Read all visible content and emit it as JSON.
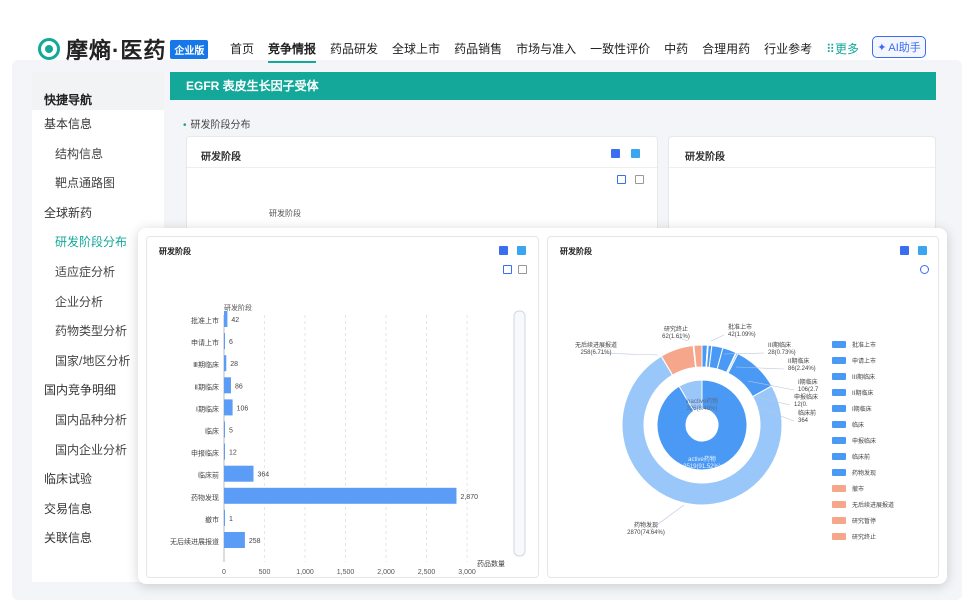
{
  "brand": {
    "name": "摩熵·医药",
    "badge": "企业版"
  },
  "nav": {
    "items": [
      "首页",
      "竞争情报",
      "药品研发",
      "全球上市",
      "药品销售",
      "市场与准入",
      "一致性评价",
      "中药",
      "合理用药",
      "行业参考"
    ],
    "active_index": 1,
    "more_label": "更多",
    "ai_label": "AI助手"
  },
  "sidebar": {
    "title": "快捷导航",
    "items": [
      {
        "label": "基本信息",
        "level": 0
      },
      {
        "label": "结构信息",
        "level": 1
      },
      {
        "label": "靶点通路图",
        "level": 1
      },
      {
        "label": "全球新药",
        "level": 0
      },
      {
        "label": "研发阶段分布",
        "level": 1,
        "selected": true
      },
      {
        "label": "适应症分析",
        "level": 1
      },
      {
        "label": "企业分析",
        "level": 1
      },
      {
        "label": "药物类型分析",
        "level": 1
      },
      {
        "label": "国家/地区分析",
        "level": 1
      },
      {
        "label": "国内竞争明细",
        "level": 0
      },
      {
        "label": "国内品种分析",
        "level": 1
      },
      {
        "label": "国内企业分析",
        "level": 1
      },
      {
        "label": "临床试验",
        "level": 0
      },
      {
        "label": "交易信息",
        "level": 0
      },
      {
        "label": "关联信息",
        "level": 0
      }
    ]
  },
  "main": {
    "header": "EGFR   表皮生长因子受体",
    "section_title": "研发阶段分布",
    "bg_card_left_title": "研发阶段",
    "bg_card_right_title": "研发阶段",
    "bg_chart_caption": "研发阶段"
  },
  "colors": {
    "accent": "#13a89a",
    "bar": "#5b9cf6",
    "ring_blue": "#4a9af5",
    "ring_orange": "#f6a68b",
    "ring_light": "#9ac7fa"
  },
  "chart_data": [
    {
      "type": "bar",
      "orientation": "horizontal",
      "title": "研发阶段",
      "caption": "研发阶段",
      "categories": [
        "批准上市",
        "申请上市",
        "III期临床",
        "II期临床",
        "I期临床",
        "临床",
        "申报临床",
        "临床前",
        "药物发现",
        "撤市",
        "无后续进展报道"
      ],
      "category_display": [
        "批准上市",
        "申请上市",
        "Ⅲ期临床",
        "Ⅱ期临床",
        "Ⅰ期临床",
        "临床",
        "申报临床",
        "临床前",
        "药物发现",
        "撤市",
        "无后续进展报道"
      ],
      "values": [
        42,
        6,
        28,
        86,
        106,
        5,
        12,
        364,
        2870,
        1,
        258
      ],
      "value_labels": [
        "42",
        "6",
        "28",
        "86",
        "106",
        "5",
        "12",
        "364",
        "2,870",
        "1",
        "258"
      ],
      "xlim": [
        0,
        3000
      ],
      "xticks": [
        "0",
        "500",
        "1,000",
        "1,500",
        "2,000",
        "2,500",
        "3,000"
      ],
      "xlabel": "药品数量",
      "grid": true
    },
    {
      "type": "pie",
      "title": "研发阶段",
      "inner": [
        {
          "name": "active药物",
          "value": 3519,
          "label": "active药物\n3519(91.52%)"
        },
        {
          "name": "inactive药物",
          "value": 326,
          "label": "inactive药物\n326(8.48%)"
        }
      ],
      "outer": [
        {
          "name": "批准上市",
          "value": 42,
          "label": "批准上市\n42(1.09%)"
        },
        {
          "name": "申请上市",
          "value": 6,
          "label": ""
        },
        {
          "name": "III期临床",
          "value": 28,
          "label": "III期临床\n28(0.73%)"
        },
        {
          "name": "II期临床",
          "value": 86,
          "label": "II期临床\n86(2.24%)"
        },
        {
          "name": "I期临床",
          "value": 106,
          "label": "I期临床\n106(2.7"
        },
        {
          "name": "临床",
          "value": 5,
          "label": ""
        },
        {
          "name": "申报临床",
          "value": 12,
          "label": "申报临床\n12(0."
        },
        {
          "name": "临床前",
          "value": 364,
          "label": "临床前\n364"
        },
        {
          "name": "药物发现",
          "value": 2870,
          "label": "药物发现\n2870(74.64%)"
        },
        {
          "name": "撤市",
          "value": 1,
          "label": ""
        },
        {
          "name": "无后续进展报道",
          "value": 258,
          "label": "无后续进展报道\n258(6.71%)"
        },
        {
          "name": "研究暂停",
          "value": 6,
          "label": ""
        },
        {
          "name": "研究终止",
          "value": 62,
          "label": "研究终止\n62(1.61%)"
        }
      ],
      "legend": [
        {
          "name": "批准上市",
          "color": "#4a9af5"
        },
        {
          "name": "申请上市",
          "color": "#4a9af5"
        },
        {
          "name": "III期临床",
          "color": "#4a9af5"
        },
        {
          "name": "II期临床",
          "color": "#4a9af5"
        },
        {
          "name": "I期临床",
          "color": "#4a9af5"
        },
        {
          "name": "临床",
          "color": "#4a9af5"
        },
        {
          "name": "申报临床",
          "color": "#4a9af5"
        },
        {
          "name": "临床前",
          "color": "#4a9af5"
        },
        {
          "name": "药物发现",
          "color": "#4a9af5"
        },
        {
          "name": "撤市",
          "color": "#f6a68b"
        },
        {
          "name": "无后续进展报道",
          "color": "#f6a68b"
        },
        {
          "name": "研究暂停",
          "color": "#f6a68b"
        },
        {
          "name": "研究终止",
          "color": "#f6a68b"
        }
      ],
      "legend_placement": "right"
    }
  ]
}
